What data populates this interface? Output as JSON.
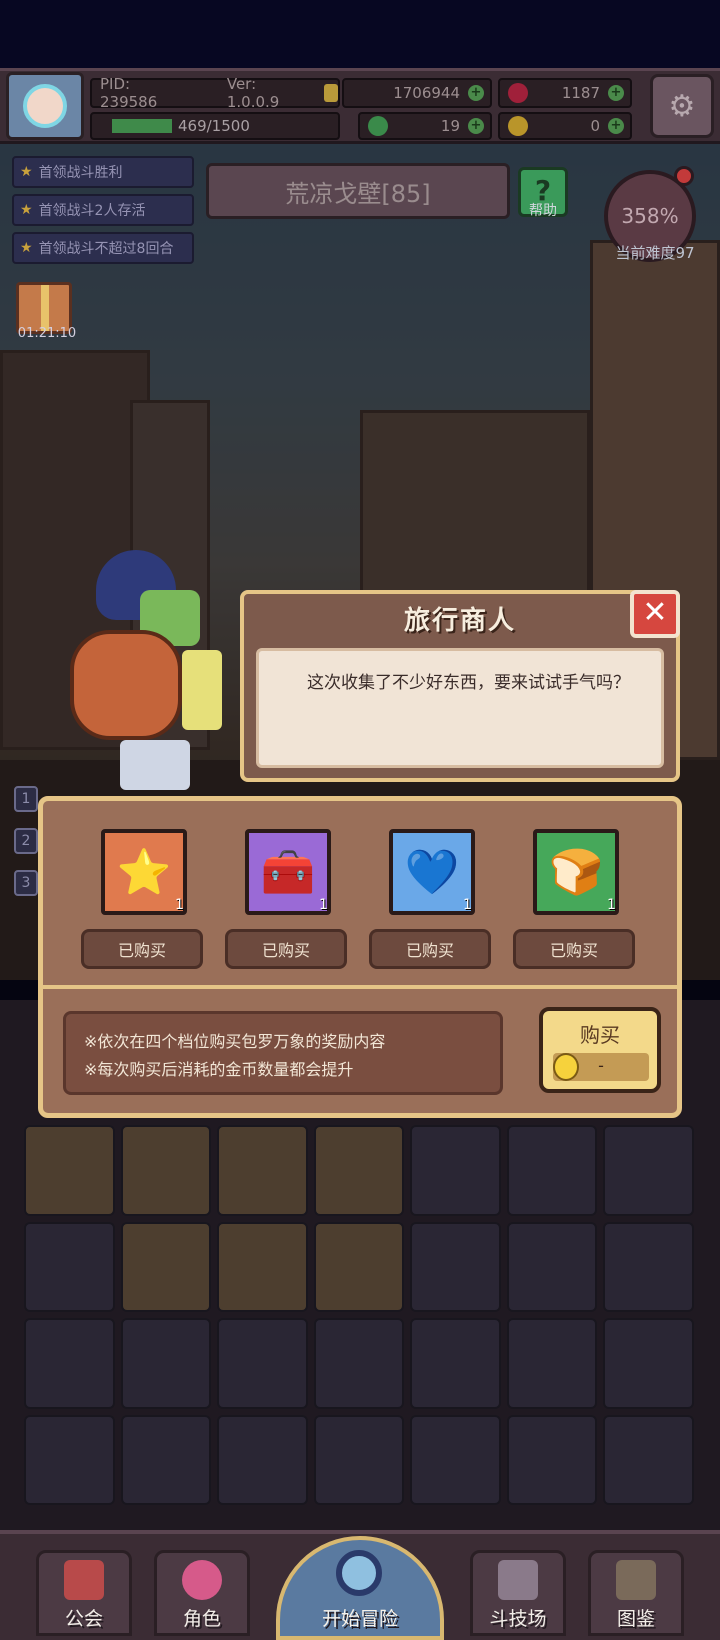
{
  "player": {
    "pid": "PID: 239586",
    "version": "Ver: 1.0.0.9",
    "gold": "1706944",
    "gems": "1187",
    "exp": "469/1500",
    "clover": "19",
    "keys": "0"
  },
  "quests": [
    "首领战斗胜利",
    "首领战斗2人存活",
    "首领战斗不超过8回合"
  ],
  "gift_timer": "01:21:10",
  "location": "荒凉戈壁[85]",
  "help_label": "帮助",
  "difficulty": {
    "percent": "358%",
    "label": "当前难度97"
  },
  "dialog": {
    "title": "旅行商人",
    "text": "这次收集了不少好东西，要来试试手气吗？"
  },
  "shop": {
    "items": [
      {
        "icon": "star-icon",
        "qty": "1",
        "button": "已购买",
        "color": "#e07a4e"
      },
      {
        "icon": "treasure-chest-icon",
        "qty": "1",
        "button": "已购买",
        "color": "#9a6ad6"
      },
      {
        "icon": "heart-icon",
        "qty": "1",
        "button": "已购买",
        "color": "#6aa8e8"
      },
      {
        "icon": "chest-icon",
        "qty": "1",
        "button": "已购买",
        "color": "#46a85a"
      }
    ],
    "notes": [
      "※依次在四个档位购买包罗万象的奖励内容",
      "※每次购买后消耗的金币数量都会提升"
    ],
    "buy_label": "购买",
    "buy_price": "-"
  },
  "side_numbers": [
    "1",
    "2",
    "3"
  ],
  "nav": [
    {
      "label": "公会",
      "icon": "guild-icon"
    },
    {
      "label": "角色",
      "icon": "character-icon"
    },
    {
      "label": "开始冒险",
      "icon": "magnifier-icon"
    },
    {
      "label": "斗技场",
      "icon": "arena-icon"
    },
    {
      "label": "图鉴",
      "icon": "codex-icon"
    }
  ]
}
